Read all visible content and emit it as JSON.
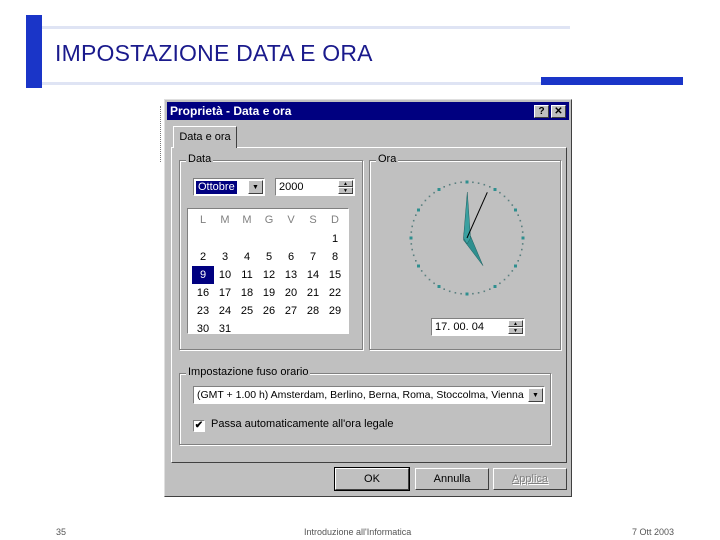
{
  "slide": {
    "title": "IMPOSTAZIONE DATA E ORA",
    "page_number": "35",
    "footer_center": "Introduzione all'Informatica",
    "footer_date": "7 Ott 2003"
  },
  "dialog": {
    "title": "Proprietà - Data e ora",
    "help_glyph": "?",
    "close_glyph": "✕",
    "tab_label": "Data e ora",
    "date_group_label": "Data",
    "time_group_label": "Ora",
    "month_value": "Ottobre",
    "year_value": "2000",
    "time_value": "17. 00. 04",
    "calendar": {
      "headers": [
        "L",
        "M",
        "M",
        "G",
        "V",
        "S",
        "D"
      ],
      "leading_blanks": 6,
      "days": [
        "1",
        "2",
        "3",
        "4",
        "5",
        "6",
        "7",
        "8",
        "9",
        "10",
        "11",
        "12",
        "13",
        "14",
        "15",
        "16",
        "17",
        "18",
        "19",
        "20",
        "21",
        "22",
        "23",
        "24",
        "25",
        "26",
        "27",
        "28",
        "29",
        "30",
        "31"
      ],
      "selected_day": "9"
    },
    "clock": {
      "hours": 17,
      "minutes": 0,
      "seconds": 4
    },
    "timezone_group_label": "Impostazione fuso orario",
    "timezone_value": "(GMT + 1.00 h) Amsterdam, Berlino, Berna, Roma, Stoccolma, Vienna",
    "dst_label": "Passa automaticamente all'ora legale",
    "dst_checked": "✔",
    "ok_label": "OK",
    "cancel_label": "Annulla",
    "apply_label": "Applica"
  },
  "colors": {
    "accent": "#1a35c8",
    "title_bar": "#000080",
    "clock_hands": "#2f8f8f"
  }
}
